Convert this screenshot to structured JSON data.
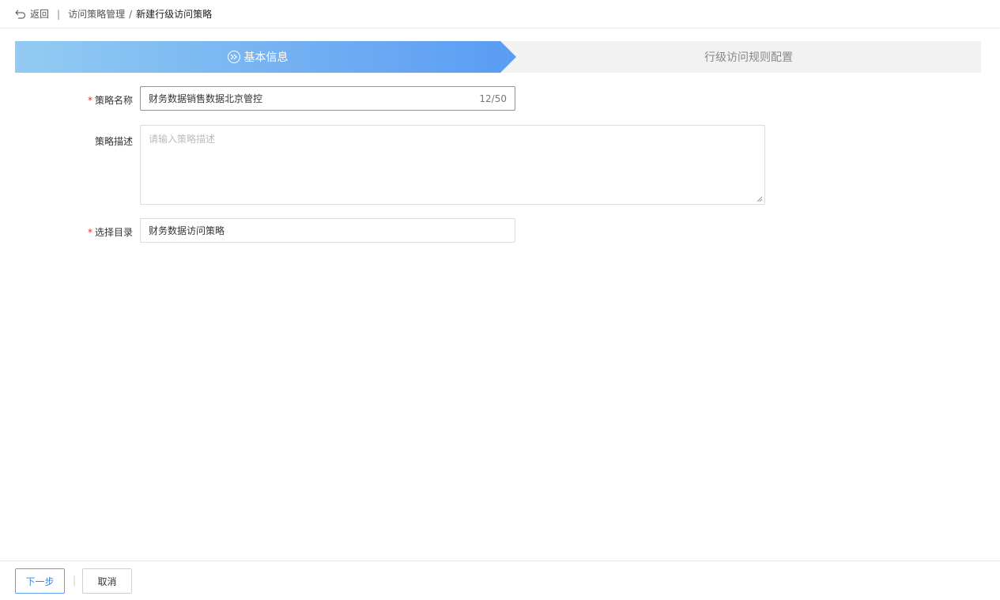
{
  "header": {
    "back_label": "返回",
    "separator": "|",
    "breadcrumb_parent": "访问策略管理",
    "breadcrumb_slash": "/",
    "breadcrumb_current": "新建行级访问策略"
  },
  "steps": [
    {
      "label": "基本信息",
      "state": "active"
    },
    {
      "label": "行级访问规则配置",
      "state": "inactive"
    }
  ],
  "form": {
    "required_mark": "*",
    "name_label": "策略名称",
    "name_value": "财务数据销售数据北京管控",
    "name_count": "12/50",
    "desc_label": "策略描述",
    "desc_placeholder": "请输入策略描述",
    "dir_label": "选择目录",
    "dir_value": "财务数据访问策略"
  },
  "footer": {
    "next_label": "下一步",
    "separator": "|",
    "cancel_label": "取消"
  },
  "colors": {
    "accent": "#5b9df3",
    "accent_light": "#93cbf2",
    "required": "#f5222d"
  }
}
